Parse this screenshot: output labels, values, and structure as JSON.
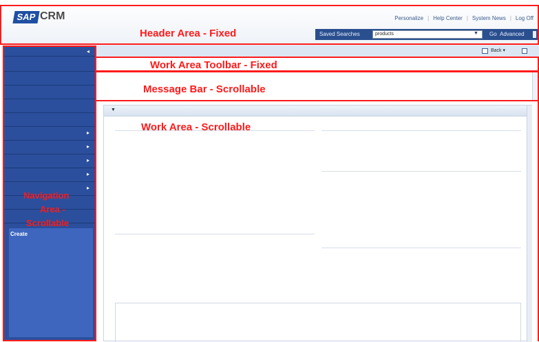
{
  "header": {
    "logo": {
      "mark": "SAP",
      "product": "CRM"
    },
    "links": [
      "Personalize",
      "Help Center",
      "System News",
      "Log Off"
    ],
    "search": {
      "saved_label": "Saved Searches",
      "value": "products",
      "go_label": "Go",
      "advanced_label": "Advanced"
    }
  },
  "toolbar": {
    "back_label": "Back"
  },
  "navigation": {
    "create_label": "Create"
  },
  "annotations": {
    "header": "Header Area - Fixed",
    "toolbar": "Work Area Toolbar  - Fixed",
    "message": "Message Bar - Scrollable",
    "work": "Work  Area - Scrollable",
    "nav_line1": "Navigation",
    "nav_line2": "Area -",
    "nav_line3": "Scrollable"
  },
  "colors": {
    "annotation": "#ff1a1a",
    "nav_bg": "#2b4f9c",
    "header_bar": "#2a4f8f"
  }
}
